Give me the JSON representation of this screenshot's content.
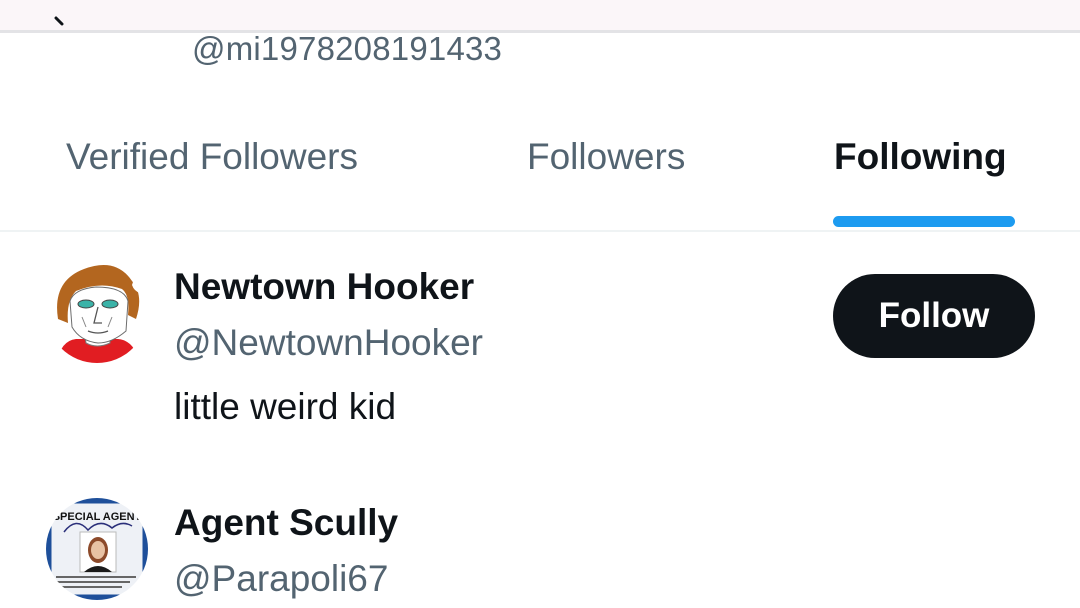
{
  "header": {
    "handle": "@mi1978208191433",
    "back_icon": "arrow-left-icon"
  },
  "tabs": [
    {
      "label": "Verified Followers",
      "active": false
    },
    {
      "label": "Followers",
      "active": false
    },
    {
      "label": "Following",
      "active": true
    }
  ],
  "accent_color": "#1d9bf0",
  "users": [
    {
      "name": "Newtown Hooker",
      "handle": "@NewtownHooker",
      "bio": "little weird kid",
      "follow_label": "Follow",
      "avatar": "cartoon-face-avatar"
    },
    {
      "name": "Agent Scully",
      "handle": "@Parapoli67",
      "avatar": "fbi-badge-avatar",
      "avatar_text": "SPECIAL AGENT"
    }
  ]
}
